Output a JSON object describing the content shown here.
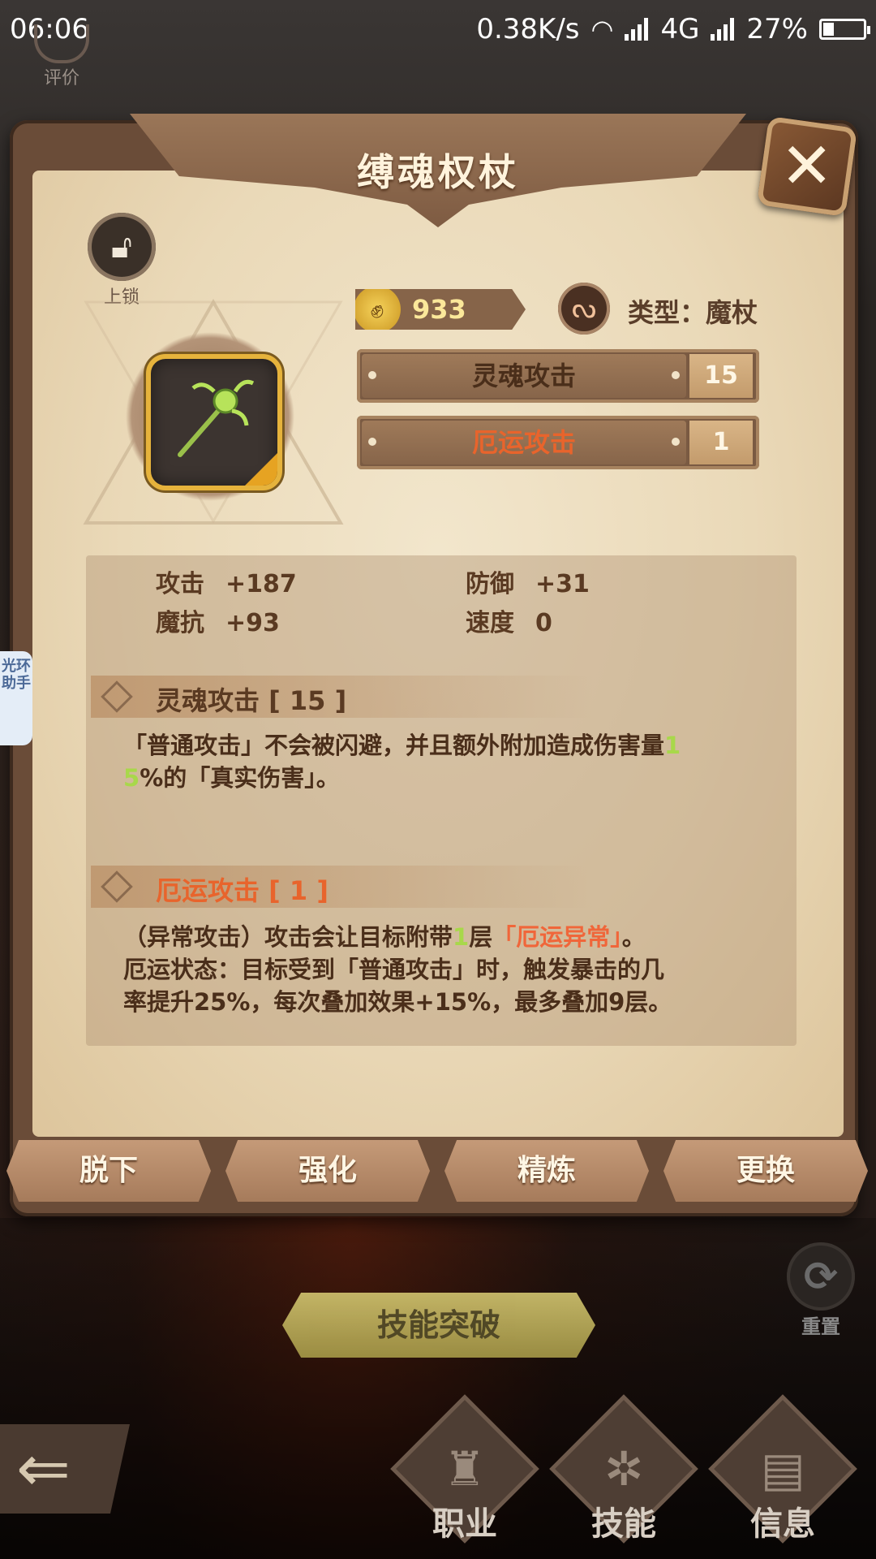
{
  "status_bar": {
    "time": "06:06",
    "net_speed": "0.38K/s",
    "network": "4G",
    "battery": "27%",
    "battery_level": 0.27
  },
  "top_left": {
    "rate_label": "评价"
  },
  "dialog": {
    "title": "缚魂权杖",
    "lock_label": "上锁",
    "power": "933",
    "type_label": "类型：魔杖",
    "skills": [
      {
        "name": "灵魂攻击",
        "level": "15",
        "color": "#4a2e1a"
      },
      {
        "name": "厄运攻击",
        "level": "1",
        "color": "#e8642c"
      }
    ],
    "stats": [
      {
        "label": "攻击",
        "value": "+187"
      },
      {
        "label": "防御",
        "value": "+31"
      },
      {
        "label": "魔抗",
        "value": "+93"
      },
      {
        "label": "速度",
        "value": "0"
      }
    ],
    "skill_details": [
      {
        "title": "灵魂攻击 [ 15 ]",
        "title_color": "#5a3a22",
        "desc_lines": [
          [
            "「普通攻击」不会被闪避，并且额外附加造成伤害量",
            "1"
          ],
          [
            "5",
            "%的「真实伤害」。"
          ]
        ]
      },
      {
        "title": "厄运攻击 [ 1 ]",
        "title_color": "#e8642c",
        "desc_line1_a": "（异常攻击）攻击会让目标附带",
        "desc_line1_b": "1",
        "desc_line1_c": "层",
        "desc_line1_d": "「厄运异常」",
        "desc_line1_e": "。",
        "desc_line2": "厄运状态：目标受到「普通攻击」时，触发暴击的几",
        "desc_line3": "率提升25%，每次叠加效果+15%，最多叠加9层。"
      }
    ],
    "actions": [
      "脱下",
      "强化",
      "精炼",
      "更换"
    ]
  },
  "scene": {
    "breakthrough_label": "技能突破",
    "reset_label": "重置",
    "nav": [
      "职业",
      "技能",
      "信息"
    ],
    "helper_tab": "光环助手"
  },
  "icons": {
    "close": "close-icon",
    "lock": "lock-icon",
    "power": "fist-icon",
    "type": "staff-type-icon",
    "item": "scepter-icon",
    "reset": "refresh-icon",
    "back": "back-arrow-icon"
  }
}
